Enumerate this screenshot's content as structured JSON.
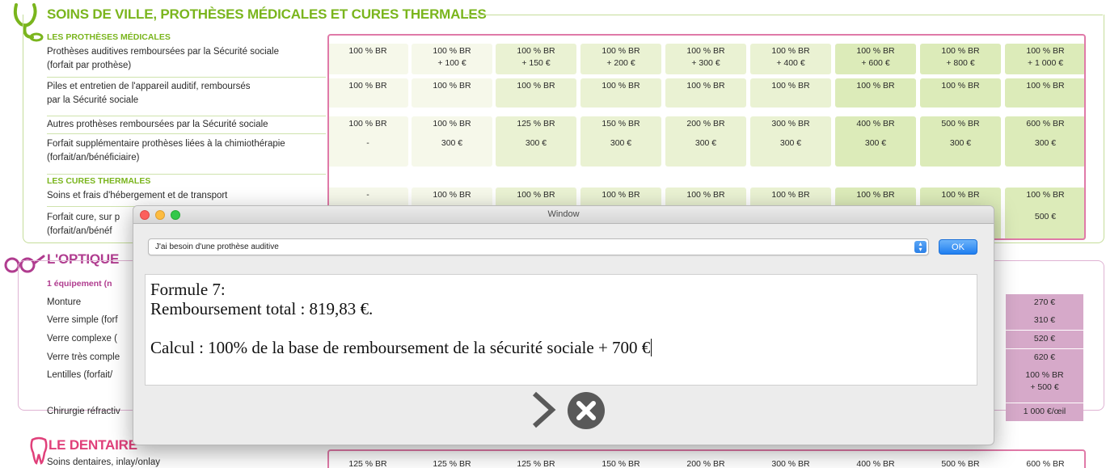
{
  "doc": {
    "soins": {
      "title": "SOINS DE VILLE, PROTHÈSES MÉDICALES ET CURES THERMALES",
      "sub_protheses": "LES PROTHÈSES MÉDICALES",
      "sub_cures": "LES CURES THERMALES",
      "rows": [
        {
          "label1": "Prothèses auditives remboursées par la Sécurité sociale",
          "label2": "(forfait par prothèse)",
          "cells": [
            [
              "100 % BR",
              ""
            ],
            [
              "100 % BR",
              "+ 100 €"
            ],
            [
              "100 % BR",
              "+ 150 €"
            ],
            [
              "100 % BR",
              "+ 200 €"
            ],
            [
              "100 % BR",
              "+ 300 €"
            ],
            [
              "100 % BR",
              "+ 400 €"
            ],
            [
              "100 % BR",
              "+ 600 €"
            ],
            [
              "100 % BR",
              "+ 800 €"
            ],
            [
              "100 % BR",
              "+ 1 000 €"
            ]
          ]
        },
        {
          "label1": "Piles et entretien de l'appareil auditif, remboursés",
          "label2": "par la Sécurité sociale",
          "cells": [
            [
              "100 % BR",
              ""
            ],
            [
              "100 % BR",
              ""
            ],
            [
              "100 % BR",
              ""
            ],
            [
              "100 % BR",
              ""
            ],
            [
              "100 % BR",
              ""
            ],
            [
              "100 % BR",
              ""
            ],
            [
              "100 % BR",
              ""
            ],
            [
              "100 % BR",
              ""
            ],
            [
              "100 % BR",
              ""
            ]
          ]
        },
        {
          "label1": "Autres prothèses remboursées par la Sécurité sociale",
          "label2": "",
          "cells": [
            [
              "100 % BR",
              ""
            ],
            [
              "100 % BR",
              ""
            ],
            [
              "125 % BR",
              ""
            ],
            [
              "150 % BR",
              ""
            ],
            [
              "200 % BR",
              ""
            ],
            [
              "300 % BR",
              ""
            ],
            [
              "400 % BR",
              ""
            ],
            [
              "500 % BR",
              ""
            ],
            [
              "600 % BR",
              ""
            ]
          ]
        },
        {
          "label1": "Forfait supplémentaire prothèses liées à la chimiothérapie",
          "label2": "(forfait/an/bénéficiaire)",
          "cells": [
            [
              "-",
              ""
            ],
            [
              "300 €",
              ""
            ],
            [
              "300 €",
              ""
            ],
            [
              "300 €",
              ""
            ],
            [
              "300 €",
              ""
            ],
            [
              "300 €",
              ""
            ],
            [
              "300 €",
              ""
            ],
            [
              "300 €",
              ""
            ],
            [
              "300 €",
              ""
            ]
          ]
        },
        {
          "label1": "Soins et frais d'hébergement et de transport",
          "label2": "",
          "cells": [
            [
              "-",
              ""
            ],
            [
              "100 % BR",
              ""
            ],
            [
              "100 % BR",
              ""
            ],
            [
              "100 % BR",
              ""
            ],
            [
              "100 % BR",
              ""
            ],
            [
              "100 % BR",
              ""
            ],
            [
              "100 % BR",
              ""
            ],
            [
              "100 % BR",
              ""
            ],
            [
              "100 % BR",
              ""
            ]
          ]
        },
        {
          "label1": "Forfait cure, sur p",
          "label2": "(forfait/an/bénéf",
          "cells": [
            [
              "",
              ""
            ],
            [
              "",
              ""
            ],
            [
              "",
              ""
            ],
            [
              "",
              ""
            ],
            [
              "",
              ""
            ],
            [
              "",
              ""
            ],
            [
              "",
              ""
            ],
            [
              "",
              ""
            ],
            [
              "500 €",
              ""
            ]
          ]
        }
      ]
    },
    "optique": {
      "title": "L'OPTIQUE",
      "sub": "1 équipement (n",
      "rows": [
        {
          "label": "Monture",
          "value1": "270 €",
          "value2": ""
        },
        {
          "label": "Verre simple (forf",
          "value1": "310 €",
          "value2": ""
        },
        {
          "label": "Verre complexe (",
          "value1": "520 €",
          "value2": ""
        },
        {
          "label": "Verre très comple",
          "value1": "620 €",
          "value2": ""
        },
        {
          "label": "Lentilles (forfait/",
          "value1": "100 % BR",
          "value2": "+ 500 €"
        },
        {
          "label": "Chirurgie réfractiv",
          "value1": "1 000 €/œil",
          "value2": ""
        }
      ]
    },
    "dentaire": {
      "title": "LE DENTAIRE",
      "row_label": "Soins dentaires, inlay/onlay",
      "cells": [
        "125 % BR",
        "125 % BR",
        "125 % BR",
        "150 % BR",
        "200 % BR",
        "300 % BR",
        "400 % BR",
        "500 % BR",
        "600 % BR"
      ]
    }
  },
  "window": {
    "title": "Window",
    "select_value": "J'ai besoin d'une prothèse auditive",
    "ok_label": "OK",
    "text_line1": "Formule 7:",
    "text_line2": "Remboursement total : 819,83 €.",
    "text_line3": "Calcul : 100% de la base de remboursement de la sécurité sociale + 700 €"
  },
  "icons": {
    "stethoscope": "stethoscope-icon",
    "glasses": "glasses-icon",
    "tooth": "tooth-icon",
    "next": "chevron-right-icon",
    "cancel": "close-circle-icon"
  },
  "colors": {
    "soins_green": "#7ab51d",
    "optique_purple": "#b03c8f",
    "dentaire_pink": "#e0407a",
    "table_border": "#e07aa8",
    "ok_blue": "#1f7ef0"
  }
}
